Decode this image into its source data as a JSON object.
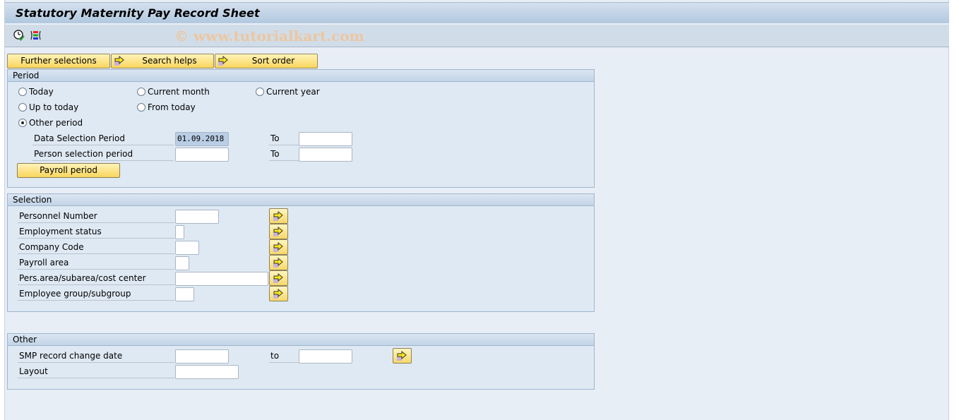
{
  "window": {
    "title": "Statutory Maternity Pay Record Sheet",
    "watermark": "© www.tutorialkart.com"
  },
  "toolbar": {
    "icons": [
      {
        "name": "execute-icon",
        "glyph": "clock-check"
      },
      {
        "name": "get-variant-icon",
        "glyph": "colored-bars"
      }
    ]
  },
  "selection_buttons": {
    "further_selections": "Further selections",
    "search_helps": "Search helps",
    "sort_order": "Sort order"
  },
  "period": {
    "header": "Period",
    "radios": {
      "today": "Today",
      "current_month": "Current month",
      "current_year": "Current year",
      "up_to_today": "Up to today",
      "from_today": "From today",
      "other_period": "Other period"
    },
    "selected": "other_period",
    "data_selection_label": "Data Selection Period",
    "data_selection_from": "01.09.2018",
    "data_selection_to": "",
    "person_selection_label": "Person selection period",
    "person_selection_from": "",
    "person_selection_to": "",
    "to_label": "To",
    "payroll_period_button": "Payroll period"
  },
  "selection": {
    "header": "Selection",
    "fields": [
      {
        "label": "Personnel Number",
        "value": ""
      },
      {
        "label": "Employment status",
        "value": ""
      },
      {
        "label": "Company Code",
        "value": ""
      },
      {
        "label": "Payroll area",
        "value": ""
      },
      {
        "label": "Pers.area/subarea/cost center",
        "value": ""
      },
      {
        "label": "Employee group/subgroup",
        "value": ""
      }
    ]
  },
  "other": {
    "header": "Other",
    "smp_label": "SMP record change date",
    "smp_from": "",
    "smp_to": "",
    "to_label": "to",
    "layout_label": "Layout",
    "layout_value": ""
  },
  "colors": {
    "button_yellow": "#f8d55d",
    "background": "#e8eef6",
    "selected_input": "#b9cde5"
  }
}
